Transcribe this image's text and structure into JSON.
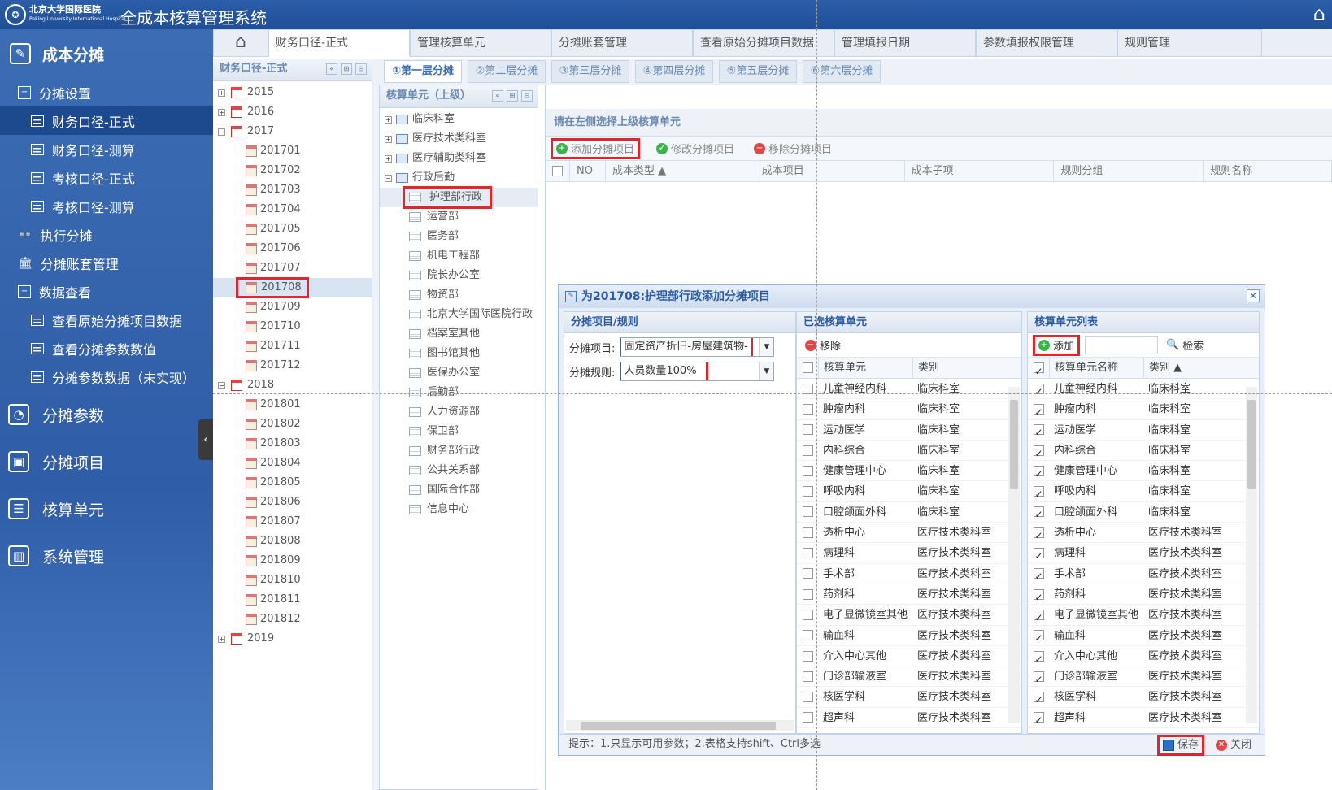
{
  "header": {
    "logo_text": "北京大学国际医院",
    "logo_sub": "Peking University International Hospital",
    "title": "全成本核算管理系统"
  },
  "sidebar": {
    "top": "成本分摊",
    "items": [
      {
        "label": "分摊设置",
        "level": 1,
        "icon": "minus-square"
      },
      {
        "label": "财务口径-正式",
        "level": 2,
        "active": true
      },
      {
        "label": "财务口径-测算",
        "level": 2
      },
      {
        "label": "考核口径-正式",
        "level": 2
      },
      {
        "label": "考核口径-测算",
        "level": 2
      },
      {
        "label": "执行分摊",
        "level": 1,
        "icon": "binoculars"
      },
      {
        "label": "分摊账套管理",
        "level": 1,
        "icon": "building"
      },
      {
        "label": "数据查看",
        "level": 1,
        "icon": "minus-square"
      },
      {
        "label": "查看原始分摊项目数据",
        "level": 2
      },
      {
        "label": "查看分摊参数数值",
        "level": 2
      },
      {
        "label": "分摊参数数据（未实现）",
        "level": 2
      }
    ],
    "big_items": [
      {
        "label": "分摊参数",
        "icon": "gauge"
      },
      {
        "label": "分摊项目",
        "icon": "image"
      },
      {
        "label": "核算单元",
        "icon": "list"
      },
      {
        "label": "系统管理",
        "icon": "bar-chart"
      }
    ]
  },
  "tabs": [
    "财务口径-正式",
    "管理核算单元",
    "分摊账套管理",
    "查看原始分摊项目数据",
    "管理填报日期",
    "参数填报权限管理",
    "规则管理"
  ],
  "period_panel": {
    "title": "财务口径-正式",
    "years": [
      {
        "year": "2015",
        "expanded": false,
        "months": []
      },
      {
        "year": "2016",
        "expanded": false,
        "months": []
      },
      {
        "year": "2017",
        "expanded": true,
        "months": [
          "201701",
          "201702",
          "201703",
          "201704",
          "201705",
          "201706",
          "201707",
          "201708",
          "201709",
          "201710",
          "201711",
          "201712"
        ]
      },
      {
        "year": "2018",
        "expanded": true,
        "months": [
          "201801",
          "201802",
          "201803",
          "201804",
          "201805",
          "201806",
          "201807",
          "201808",
          "201809",
          "201810",
          "201811",
          "201812"
        ]
      },
      {
        "year": "2019",
        "expanded": false,
        "months": []
      }
    ],
    "selected": "201708"
  },
  "layer_tabs": [
    "①第一层分摊",
    "②第二层分摊",
    "③第三层分摊",
    "④第四层分摊",
    "⑤第五层分摊",
    "⑥第六层分摊"
  ],
  "unit_panel": {
    "title": "核算单元（上级）",
    "groups": [
      "临床科室",
      "医疗技术类科室",
      "医疗辅助类科室",
      "行政后勤"
    ],
    "children": [
      "护理部行政",
      "运营部",
      "医务部",
      "机电工程部",
      "院长办公室",
      "物资部",
      "北京大学国际医院行政",
      "档案室其他",
      "图书馆其他",
      "医保办公室",
      "后勤部",
      "人力资源部",
      "保卫部",
      "财务部行政",
      "公共关系部",
      "国际合作部",
      "信息中心"
    ],
    "selected": "护理部行政"
  },
  "main": {
    "note": "请在左侧选择上级核算单元",
    "toolbar": {
      "add": "添加分摊项目",
      "edit": "修改分摊项目",
      "remove": "移除分摊项目"
    },
    "columns": [
      "NO",
      "成本类型",
      "成本项目",
      "成本子项",
      "规则分组",
      "规则名称"
    ]
  },
  "dialog": {
    "title": "为201708:护理部行政添加分摊项目",
    "sec1": {
      "title": "分摊项目/规则",
      "item_label": "分摊项目:",
      "item_value": "固定资产折旧-房屋建筑物-",
      "rule_label": "分摊规则:",
      "rule_value": "人员数量100%"
    },
    "sec2": {
      "title": "已选核算单元",
      "remove": "移除",
      "col1": "核算单元",
      "col2": "类别"
    },
    "sec3": {
      "title": "核算单元列表",
      "add": "添加",
      "search": "检索",
      "search_value": "",
      "col1": "核算单元名称",
      "col2": "类别 ▲"
    },
    "rows": [
      [
        "儿童神经内科",
        "临床科室"
      ],
      [
        "肿瘤内科",
        "临床科室"
      ],
      [
        "运动医学",
        "临床科室"
      ],
      [
        "内科综合",
        "临床科室"
      ],
      [
        "健康管理中心",
        "临床科室"
      ],
      [
        "呼吸内科",
        "临床科室"
      ],
      [
        "口腔颌面外科",
        "临床科室"
      ],
      [
        "透析中心",
        "医疗技术类科室"
      ],
      [
        "病理科",
        "医疗技术类科室"
      ],
      [
        "手术部",
        "医疗技术类科室"
      ],
      [
        "药剂科",
        "医疗技术类科室"
      ],
      [
        "电子显微镜室其他",
        "医疗技术类科室"
      ],
      [
        "输血科",
        "医疗技术类科室"
      ],
      [
        "介入中心其他",
        "医疗技术类科室"
      ],
      [
        "门诊部输液室",
        "医疗技术类科室"
      ],
      [
        "核医学科",
        "医疗技术类科室"
      ],
      [
        "超声科",
        "医疗技术类科室"
      ]
    ],
    "footer": "提示：1.只显示可用参数；2.表格支持shift、Ctrl多选",
    "save": "保存",
    "close": "关闭"
  },
  "colors": {
    "header": "#2c5ea9",
    "sidebar": "#3c6db4",
    "highlight": "#e0262a",
    "panel_title": "#6a88b0"
  }
}
